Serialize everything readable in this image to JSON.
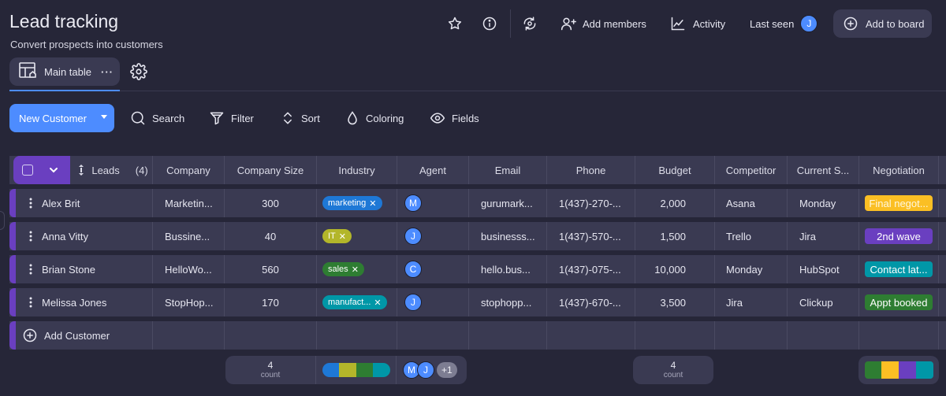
{
  "header": {
    "title": "Lead tracking",
    "subtitle": "Convert prospects into customers",
    "add_members_label": "Add members",
    "activity_label": "Activity",
    "last_seen_label": "Last seen",
    "last_seen_avatar": "J",
    "add_to_board_label": "Add to board"
  },
  "views": {
    "tabs": [
      {
        "label": "Main table",
        "active": true
      }
    ]
  },
  "toolbar": {
    "new_button_label": "New Customer",
    "search_label": "Search",
    "filter_label": "Filter",
    "sort_label": "Sort",
    "coloring_label": "Coloring",
    "fields_label": "Fields"
  },
  "colors": {
    "accent": "#4d8cff",
    "group": "#6a3fc0",
    "background": "#262638",
    "cell": "#3a3a52"
  },
  "table": {
    "group_label": "Leads",
    "group_count": "(4)",
    "columns": [
      "Company",
      "Company Size",
      "Industry",
      "Agent",
      "Email",
      "Phone",
      "Budget",
      "Competitor",
      "Current S...",
      "Negotiation"
    ],
    "rows": [
      {
        "name": "Alex Brit",
        "company": "Marketin...",
        "size": "300",
        "industry": {
          "label": "marketing",
          "color": "#1e78d6"
        },
        "agent": "M",
        "email": "gurumark...",
        "phone": "1(437)-270-...",
        "budget": "2,000",
        "competitor": "Asana",
        "current": "Monday",
        "negotiation": {
          "label": "Final negot...",
          "color": "#fbbf24"
        }
      },
      {
        "name": "Anna Vitty",
        "company": "Bussine...",
        "size": "40",
        "industry": {
          "label": "IT",
          "color": "#b3b62a"
        },
        "agent": "J",
        "email": "businesss...",
        "phone": "1(437)-570-...",
        "budget": "1,500",
        "competitor": "Trello",
        "current": "Jira",
        "negotiation": {
          "label": "2nd wave",
          "color": "#6a3fc0"
        }
      },
      {
        "name": "Brian Stone",
        "company": "HelloWo...",
        "size": "560",
        "industry": {
          "label": "sales",
          "color": "#2e7d32"
        },
        "agent": "C",
        "email": "hello.bus...",
        "phone": "1(437)-075-...",
        "budget": "10,000",
        "competitor": "Monday",
        "current": "HubSpot",
        "negotiation": {
          "label": "Contact lat...",
          "color": "#0097a7"
        }
      },
      {
        "name": "Melissa Jones",
        "company": "StopHop...",
        "size": "170",
        "industry": {
          "label": "manufact...",
          "color": "#0097a7"
        },
        "agent": "J",
        "email": "stophopp...",
        "phone": "1(437)-670-...",
        "budget": "3,500",
        "competitor": "Jira",
        "current": "Clickup",
        "negotiation": {
          "label": "Appt booked",
          "color": "#2e7d32"
        }
      }
    ],
    "add_row_label": "Add Customer"
  },
  "summary": {
    "size_count": "4",
    "size_count_label": "count",
    "industry_segments": [
      "#1e78d6",
      "#b3b62a",
      "#2e7d32",
      "#0097a7"
    ],
    "agents": [
      "M",
      "J"
    ],
    "agents_more": "+1",
    "budget_count": "4",
    "budget_count_label": "count",
    "negotiation_segments": [
      "#2e7d32",
      "#fbbf24",
      "#6a3fc0",
      "#0097a7"
    ]
  }
}
